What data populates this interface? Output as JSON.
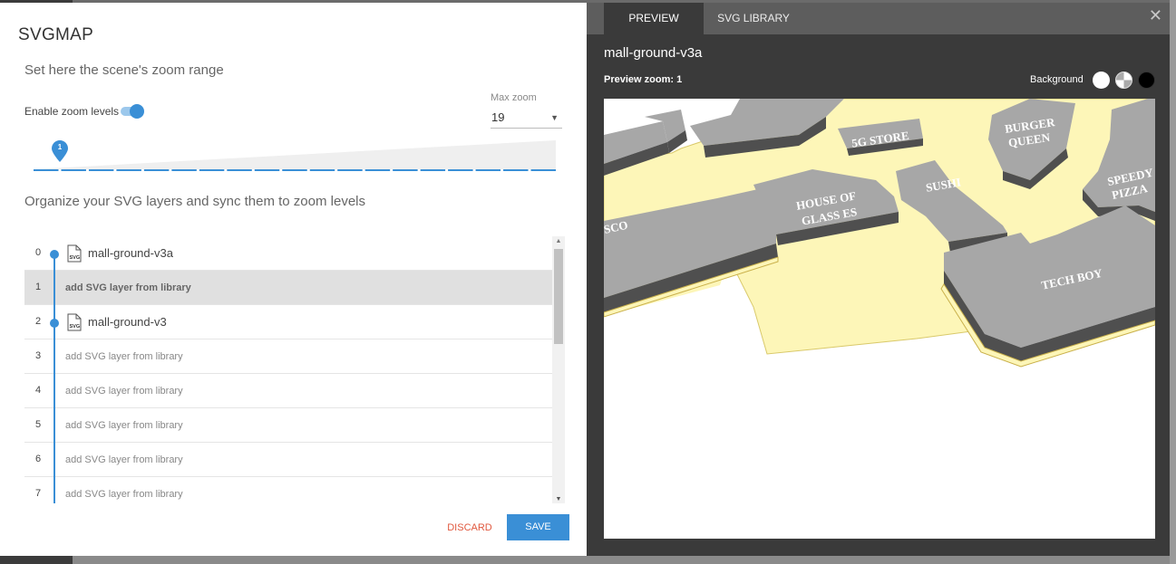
{
  "app": {
    "title": "SVGMAP"
  },
  "zoom_section": {
    "heading": "Set here the scene's zoom range",
    "toggle_label": "Enable zoom levels",
    "toggle_on": true,
    "max_zoom_label": "Max zoom",
    "max_zoom_value": "19",
    "current_level": "1",
    "level_count": 19
  },
  "layers_section": {
    "heading": "Organize your SVG layers and sync them to zoom levels",
    "file_icon_text": "SVG",
    "rows": [
      {
        "index": "0",
        "name": "mall-ground-v3a",
        "has_layer": true,
        "selected": false
      },
      {
        "index": "1",
        "name": "add SVG layer from library",
        "has_layer": false,
        "selected": true
      },
      {
        "index": "2",
        "name": "mall-ground-v3",
        "has_layer": true,
        "selected": false
      },
      {
        "index": "3",
        "name": "add SVG layer from library",
        "has_layer": false,
        "selected": false
      },
      {
        "index": "4",
        "name": "add SVG layer from library",
        "has_layer": false,
        "selected": false
      },
      {
        "index": "5",
        "name": "add SVG layer from library",
        "has_layer": false,
        "selected": false
      },
      {
        "index": "6",
        "name": "add SVG layer from library",
        "has_layer": false,
        "selected": false
      },
      {
        "index": "7",
        "name": "add SVG layer from library",
        "has_layer": false,
        "selected": false
      }
    ]
  },
  "actions": {
    "discard_label": "DISCARD",
    "save_label": "SAVE"
  },
  "tabs": [
    {
      "label": "PREVIEW",
      "active": true
    },
    {
      "label": "SVG LIBRARY",
      "active": false
    }
  ],
  "preview": {
    "title": "mall-ground-v3a",
    "zoom_label": "Preview zoom: 1",
    "background_label": "Background",
    "background_options": [
      "white",
      "checker",
      "black"
    ]
  },
  "map": {
    "stores": [
      {
        "name": "5G STORE"
      },
      {
        "name": "BURGER",
        "line2": "QUEEN"
      },
      {
        "name": "SPEEDY",
        "line2": "PIZZA"
      },
      {
        "name": "HOUSE OF",
        "line2": "GLASS ES"
      },
      {
        "name": "SUSHI"
      },
      {
        "name": "SCO"
      },
      {
        "name": "TECH BOY"
      }
    ]
  },
  "colors": {
    "accent": "#3a8fd6",
    "discard": "#e0573d",
    "floor": "#fdf6b8",
    "store_top": "#a7a7a7",
    "store_side": "#4f4f4f"
  }
}
